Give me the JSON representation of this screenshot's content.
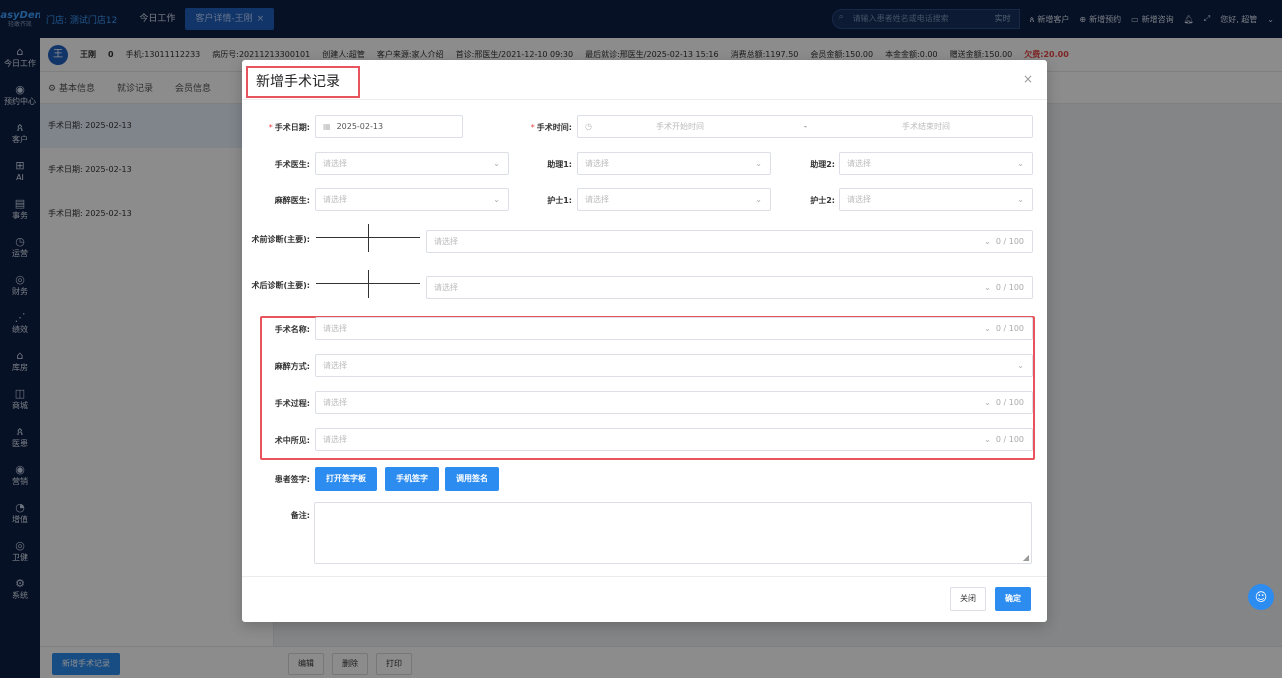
{
  "brand": {
    "name": "EasyDent",
    "sub": "轻敢齐凯"
  },
  "sidebar": {
    "items": [
      {
        "label": "今日工作",
        "icon": "⌂"
      },
      {
        "label": "预约中心",
        "icon": "◉"
      },
      {
        "label": "客户",
        "icon": "ጰ"
      },
      {
        "label": "AI",
        "icon": "⊞"
      },
      {
        "label": "事务",
        "icon": "▤"
      },
      {
        "label": "运营",
        "icon": "◷"
      },
      {
        "label": "财务",
        "icon": "◎"
      },
      {
        "label": "绩效",
        "icon": "⋰"
      },
      {
        "label": "库房",
        "icon": "⌂"
      },
      {
        "label": "商城",
        "icon": "◫"
      },
      {
        "label": "医患",
        "icon": "ጰ"
      },
      {
        "label": "营销",
        "icon": "◉"
      },
      {
        "label": "增值",
        "icon": "◔"
      },
      {
        "label": "卫健",
        "icon": "◎"
      },
      {
        "label": "系统",
        "icon": "⚙"
      }
    ]
  },
  "topbar": {
    "store": "门店: 测试门店12",
    "tabs": [
      "今日工作",
      "客户详情-王刚"
    ],
    "active_tab_close": "×",
    "search_placeholder": "请输入患者姓名或电话搜索",
    "search_button": "实时",
    "actions": [
      {
        "label": "新增客户",
        "icon": "ጰ"
      },
      {
        "label": "新增预约",
        "icon": "⊕"
      },
      {
        "label": "新增咨询",
        "icon": "▭"
      }
    ],
    "bell_icon": "♫",
    "expand_icon": "⤢",
    "greeting": "您好, 超管"
  },
  "patient": {
    "avatar": "王",
    "name": "王刚",
    "age": "0",
    "phone": "手机:13011112233",
    "record_no": "病历号:20211213300101",
    "creator": "创建人:超管",
    "source": "客户来源:家人介绍",
    "first_visit": "首诊:邢医生/2021-12-10 09:30",
    "last_visit": "最后就诊:邢医生/2025-02-13 15:16",
    "total_spend": "消费总额:1197.50",
    "member_amount": "会员金额:150.00",
    "principal": "本金金额:0.00",
    "gift": "赠送金额:150.00",
    "owed": "欠费:20.00"
  },
  "subtabs": [
    "基本信息",
    "就诊记录",
    "会员信息"
  ],
  "records": [
    "手术日期: 2025-02-13",
    "手术日期: 2025-02-13",
    "手术日期: 2025-02-13"
  ],
  "bottom": {
    "new_button": "新增手术记录",
    "edit": "编辑",
    "delete": "删除",
    "print": "打印"
  },
  "modal": {
    "title": "新增手术记录",
    "close_icon": "×",
    "surgery_date_label": "手术日期:",
    "surgery_date_value": "2025-02-13",
    "surgery_time_label": "手术时间:",
    "start_placeholder": "手术开始时间",
    "range_sep": "-",
    "end_placeholder": "手术结束时间",
    "doctor_label": "手术医生:",
    "assistant1_label": "助理1:",
    "assistant2_label": "助理2:",
    "anesthetist_label": "麻醉医生:",
    "nurse1_label": "护士1:",
    "nurse2_label": "护士2:",
    "select_placeholder": "请选择",
    "pre_diag_label": "术前诊断(主要):",
    "post_diag_label": "术后诊断(主要):",
    "surgery_name_label": "手术名称:",
    "anesthesia_label": "麻醉方式:",
    "process_label": "手术过程:",
    "findings_label": "术中所见:",
    "counter": "0 / 100",
    "signature_label": "患者签字:",
    "sign_buttons": [
      "打开签字板",
      "手机签字",
      "调用签名"
    ],
    "remark_label": "备注:",
    "close_button": "关闭",
    "confirm_button": "确定"
  },
  "colors": {
    "primary": "#2d8cf0",
    "sidebar": "#0b1f45",
    "highlight": "#e8545e",
    "danger": "#e64545"
  }
}
